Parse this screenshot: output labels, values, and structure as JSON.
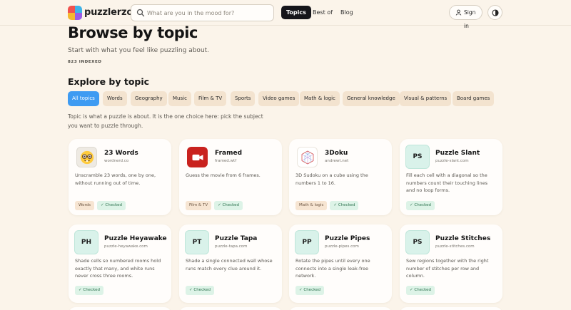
{
  "header": {
    "logo_text": "puzzlerzone",
    "search_placeholder": "What are you in the mood for?",
    "nav": [
      {
        "label": "Topics",
        "active": true
      },
      {
        "label": "Best of",
        "active": false
      },
      {
        "label": "Blog",
        "active": false
      }
    ],
    "signin_label": "Sign in",
    "icons": {
      "search": "search-icon",
      "user": "user-icon",
      "theme": "contrast-icon"
    }
  },
  "hero": {
    "title": "Browse by topic",
    "subtitle": "Start with what you feel like puzzling about.",
    "count": "823 INDEXED"
  },
  "explore": {
    "title": "Explore by topic",
    "chips": [
      {
        "label": "All topics",
        "active": true
      },
      {
        "label": "Words",
        "active": false
      },
      {
        "label": "Geography",
        "active": false
      },
      {
        "label": "Music",
        "active": false
      },
      {
        "label": "Film & TV",
        "active": false
      },
      {
        "label": "Sports",
        "active": false
      },
      {
        "label": "Video games",
        "active": false
      },
      {
        "label": "Math & logic",
        "active": false
      },
      {
        "label": "General knowledge",
        "active": false
      },
      {
        "label": "Visual & patterns",
        "active": false
      },
      {
        "label": "Board games",
        "active": false
      }
    ],
    "description": "Topic is what a puzzle is about. It is the one choice here: pick the subject you want to puzzle through."
  },
  "cards": [
    {
      "title": "23 Words",
      "url": "wordnerd.co",
      "description": "Unscramble 23 words, one by one, without running out of time.",
      "topic": "Words",
      "checked": "✓ Checked",
      "icon": "nerd-face-icon"
    },
    {
      "title": "Framed",
      "url": "framed.wtf",
      "description": "Guess the movie from 6 frames.",
      "topic": "Film & TV",
      "checked": "✓ Checked",
      "icon": "video-camera-icon"
    },
    {
      "title": "3Doku",
      "url": "andrewt.net",
      "description": "3D Sudoku on a cube using the numbers 1 to 16.",
      "topic": "Math & logic",
      "checked": "✓ Checked",
      "icon": "cube-grid-icon"
    },
    {
      "title": "Puzzle Slant",
      "url": "puzzle-slant.com",
      "description": "Fill each cell with a diagonal so the numbers count their touching lines and no loop forms.",
      "topic": "",
      "checked": "✓ Checked",
      "icon_text": "PS"
    },
    {
      "title": "Puzzle Heyawake",
      "url": "puzzle-heyawake.com",
      "description": "Shade cells so numbered rooms hold exactly that many, and white runs never cross three rooms.",
      "topic": "",
      "checked": "✓ Checked",
      "icon_text": "PH"
    },
    {
      "title": "Puzzle Tapa",
      "url": "puzzle-tapa.com",
      "description": "Shade a single connected wall whose runs match every clue around it.",
      "topic": "",
      "checked": "✓ Checked",
      "icon_text": "PT"
    },
    {
      "title": "Puzzle Pipes",
      "url": "puzzle-pipes.com",
      "description": "Rotate the pipes until every one connects into a single leak-free network.",
      "topic": "",
      "checked": "✓ Checked",
      "icon_text": "PP"
    },
    {
      "title": "Puzzle Stitches",
      "url": "puzzle-stitches.com",
      "description": "Sew regions together with the right number of stitches per row and column.",
      "topic": "",
      "checked": "✓ Checked",
      "icon_text": "PS"
    }
  ],
  "colors": {
    "background": "#fbf4ea",
    "accent": "#3e9bf2",
    "chip": "#f3e3cf",
    "checked_bg": "#ddf3e7",
    "icon_tile": "#d9f2ea"
  }
}
